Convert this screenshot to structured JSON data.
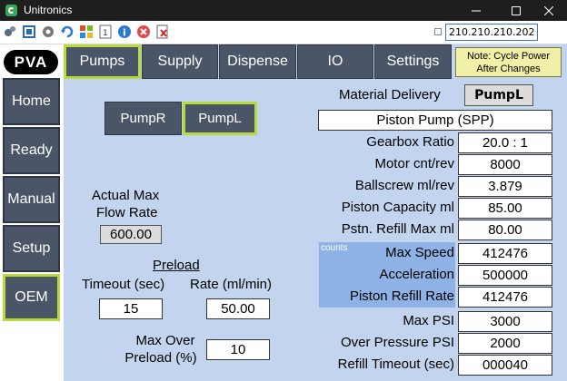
{
  "window": {
    "title": "Unitronics"
  },
  "toolbar": {
    "ip_address": "210.210.210.202"
  },
  "logo": {
    "text": "PVA"
  },
  "sidebar": {
    "items": [
      {
        "label": "Home"
      },
      {
        "label": "Ready"
      },
      {
        "label": "Manual"
      },
      {
        "label": "Setup"
      },
      {
        "label": "OEM",
        "active": true
      }
    ]
  },
  "tabs": [
    {
      "label": "Pumps",
      "active": true
    },
    {
      "label": "Supply"
    },
    {
      "label": "Dispense"
    },
    {
      "label": "IO"
    },
    {
      "label": "Settings"
    }
  ],
  "note": {
    "line1": "Note: Cycle Power",
    "line2": "After Changes"
  },
  "pump_select": {
    "pump_r": "PumpR",
    "pump_l": "PumpL",
    "selected": "PumpL"
  },
  "flow": {
    "label_line1": "Actual Max",
    "label_line2": "Flow Rate",
    "value": "600.00"
  },
  "preload": {
    "heading": "Preload",
    "timeout_label": "Timeout (sec)",
    "timeout_value": "15",
    "rate_label": "Rate (ml/min)",
    "rate_value": "50.00",
    "max_over_line1": "Max Over",
    "max_over_line2": "Preload (%)",
    "max_over_value": "10"
  },
  "material": {
    "label": "Material Delivery",
    "value": "PumpL",
    "pump_type": "Piston Pump (SPP)"
  },
  "params": [
    {
      "label": "Gearbox Ratio",
      "value": "20.0 : 1"
    },
    {
      "label": "Motor cnt/rev",
      "value": "8000"
    },
    {
      "label": "Ballscrew ml/rev",
      "value": "3.879"
    },
    {
      "label": "Piston Capacity ml",
      "value": "85.00"
    },
    {
      "label": "Pstn. Refill Max ml",
      "value": "80.00"
    }
  ],
  "counts": {
    "label": "counts",
    "rows": [
      {
        "label": "Max Speed",
        "value": "412476"
      },
      {
        "label": "Acceleration",
        "value": "500000"
      },
      {
        "label": "Piston Refill Rate",
        "value": "412476"
      }
    ]
  },
  "limits": [
    {
      "label": "Max PSI",
      "value": "3000"
    },
    {
      "label": "Over Pressure PSI",
      "value": "2000"
    },
    {
      "label": "Refill Timeout (sec)",
      "value": "000040"
    }
  ],
  "colors": {
    "panel_bg": "#c3d5ee",
    "button": "#4a5567",
    "active_border": "#b8da3a",
    "note_bg": "#f0f0a8"
  }
}
